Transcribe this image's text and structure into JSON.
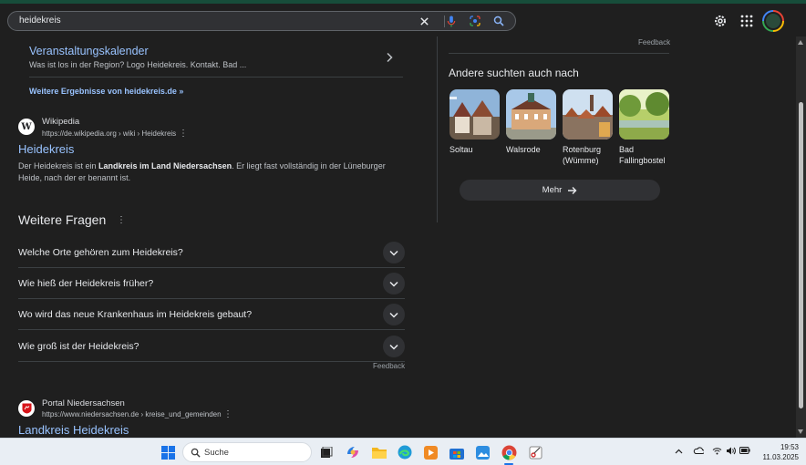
{
  "search": {
    "query": "heidekreis"
  },
  "sitelink": {
    "title": "Veranstaltungskalender",
    "description": "Was ist los in der Region? Logo Heidekreis. Kontakt. Bad ..."
  },
  "more_results": "Weitere Ergebnisse von heidekreis.de »",
  "wikipedia": {
    "source": "Wikipedia",
    "url": "https://de.wikipedia.org › wiki › Heidekreis",
    "title": "Heidekreis",
    "snippet_pre": "Der Heidekreis ist ein ",
    "snippet_bold": "Landkreis im Land Niedersachsen",
    "snippet_post": ". Er liegt fast vollständig in der Lüneburger Heide, nach der er benannt ist."
  },
  "paa": {
    "title": "Weitere Fragen",
    "questions": [
      "Welche Orte gehören zum Heidekreis?",
      "Wie hieß der Heidekreis früher?",
      "Wo wird das neue Krankenhaus im Heidekreis gebaut?",
      "Wie groß ist der Heidekreis?"
    ],
    "feedback": "Feedback"
  },
  "portal": {
    "source": "Portal Niedersachsen",
    "url": "https://www.niedersachsen.de › kreise_und_gemeinden",
    "title": "Landkreis Heidekreis"
  },
  "right": {
    "feedback": "Feedback",
    "also_title": "Andere suchten auch nach",
    "cards": [
      {
        "label": "Soltau"
      },
      {
        "label": "Walsrode"
      },
      {
        "label": "Rotenburg (Wümme)"
      },
      {
        "label": "Bad Fallingbostel"
      }
    ],
    "more": "Mehr"
  },
  "taskbar": {
    "search_label": "Suche",
    "time": "19:53",
    "date": "11.03.2025"
  },
  "icons": [
    "close-icon",
    "mic-icon",
    "lens-icon",
    "search-icon",
    "gear-icon",
    "apps-icon",
    "chevron-right-icon",
    "chevron-down-icon",
    "arrow-right-icon",
    "windows-start-icon",
    "chrome-icon"
  ]
}
